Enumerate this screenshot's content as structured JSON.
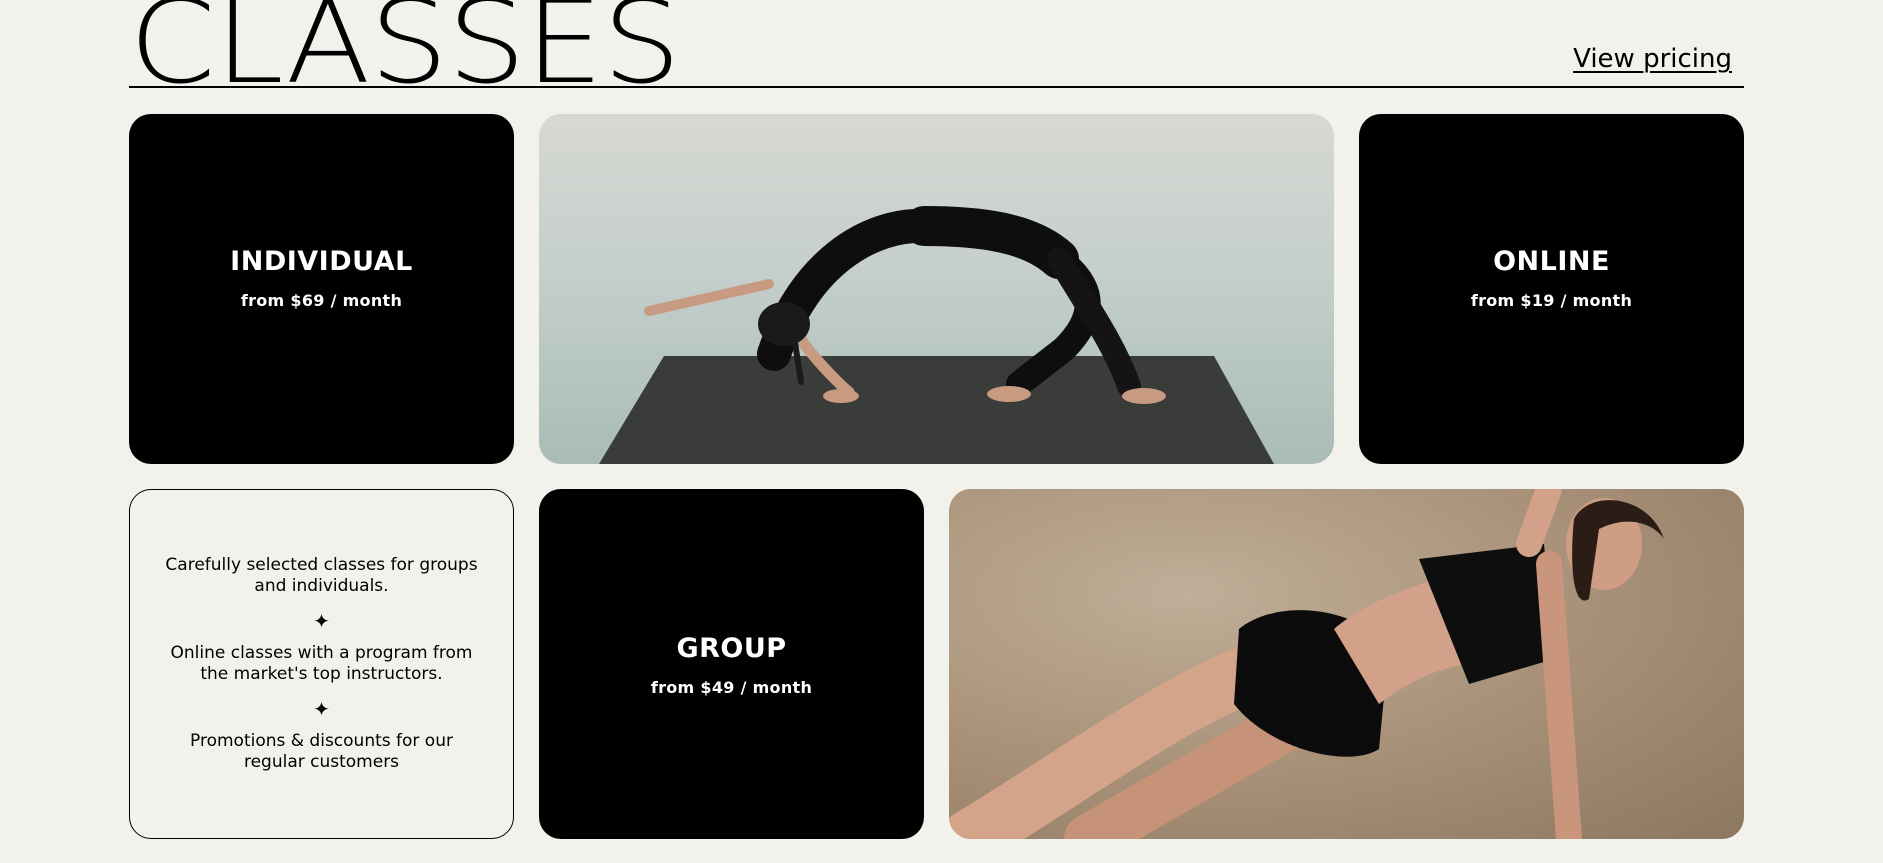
{
  "header": {
    "title": "CLASSES",
    "pricing_link": "View pricing"
  },
  "cards": {
    "individual": {
      "title": "INDIVIDUAL",
      "price": "from $69 / month"
    },
    "online": {
      "title": "ONLINE",
      "price": "from $19 / month"
    },
    "group": {
      "title": "GROUP",
      "price": "from $49 / month"
    }
  },
  "features": {
    "item1": "Carefully selected classes for groups and individuals.",
    "item2": "Online classes with a program from the market's top instructors.",
    "item3": "Promotions & discounts for our regular customers",
    "separator_icon": "sparkle-icon"
  },
  "colors": {
    "background": "#f3f1ec",
    "card": "#000000",
    "text_on_card": "#ffffff"
  }
}
